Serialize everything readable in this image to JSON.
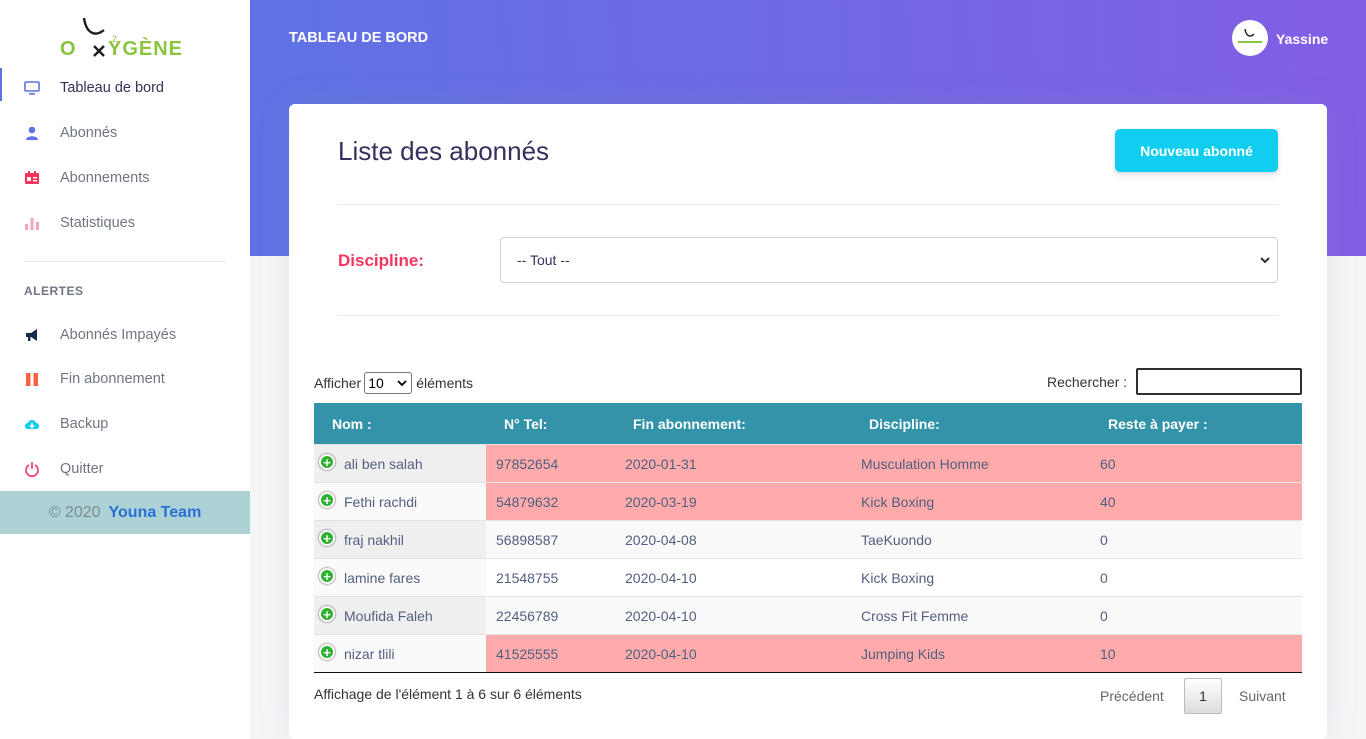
{
  "sidebar": {
    "logo_text": "OXYGÈNE",
    "items": [
      {
        "label": "Tableau de bord",
        "icon": "monitor-icon",
        "color": "#5e72e4"
      },
      {
        "label": "Abonnés",
        "icon": "user-icon",
        "color": "#5e72e4"
      },
      {
        "label": "Abonnements",
        "icon": "id-card-icon",
        "color": "#f5365c"
      },
      {
        "label": "Statistiques",
        "icon": "bar-chart-icon",
        "color": "#f3a4b5"
      }
    ],
    "alerts_heading": "ALERTES",
    "alert_items": [
      {
        "label": "Abonnés Impayés",
        "icon": "megaphone-icon",
        "color": "#172b4d"
      },
      {
        "label": "Fin abonnement",
        "icon": "pause-icon",
        "color": "#fb6340"
      },
      {
        "label": "Backup",
        "icon": "cloud-download-icon",
        "color": "#11cdef"
      },
      {
        "label": "Quitter",
        "icon": "power-icon",
        "color": "#f5365c"
      }
    ],
    "copyright": "© 2020",
    "team": "Youna Team"
  },
  "header": {
    "title": "TABLEAU DE BORD",
    "user_name": "Yassine"
  },
  "card": {
    "title": "Liste des abonnés",
    "new_button": "Nouveau abonné",
    "filter_label": "Discipline:",
    "filter_value": "-- Tout --"
  },
  "table_controls": {
    "show_prefix": "Afficher",
    "page_length": "10",
    "show_suffix": "éléments",
    "search_label": "Rechercher :",
    "search_value": ""
  },
  "table": {
    "columns": [
      "Nom :",
      "N° Tel:",
      "Fin abonnement:",
      "Discipline:",
      "Reste à payer :"
    ],
    "rows": [
      {
        "nom": "ali ben salah",
        "tel": "97852654",
        "fin": "2020-01-31",
        "discipline": "Musculation Homme",
        "reste": "60",
        "late": true
      },
      {
        "nom": "Fethi rachdi",
        "tel": "54879632",
        "fin": "2020-03-19",
        "discipline": "Kick Boxing",
        "reste": "40",
        "late": true
      },
      {
        "nom": "fraj nakhil",
        "tel": "56898587",
        "fin": "2020-04-08",
        "discipline": "TaeKuondo",
        "reste": "0",
        "late": false
      },
      {
        "nom": "lamine fares",
        "tel": "21548755",
        "fin": "2020-04-10",
        "discipline": "Kick Boxing",
        "reste": "0",
        "late": false
      },
      {
        "nom": "Moufida Faleh",
        "tel": "22456789",
        "fin": "2020-04-10",
        "discipline": "Cross Fit Femme",
        "reste": "0",
        "late": false
      },
      {
        "nom": "nizar tlili",
        "tel": "41525555",
        "fin": "2020-04-10",
        "discipline": "Jumping Kids",
        "reste": "10",
        "late": true
      }
    ]
  },
  "footer": {
    "info": "Affichage de l'élément 1 à 6 sur 6 éléments",
    "prev": "Précédent",
    "page": "1",
    "next": "Suivant"
  },
  "colors": {
    "accent": "#5e72e4",
    "table_header": "#3393a8",
    "late_row": "#ffabab",
    "info_button": "#11cdef",
    "danger": "#f5365c"
  }
}
